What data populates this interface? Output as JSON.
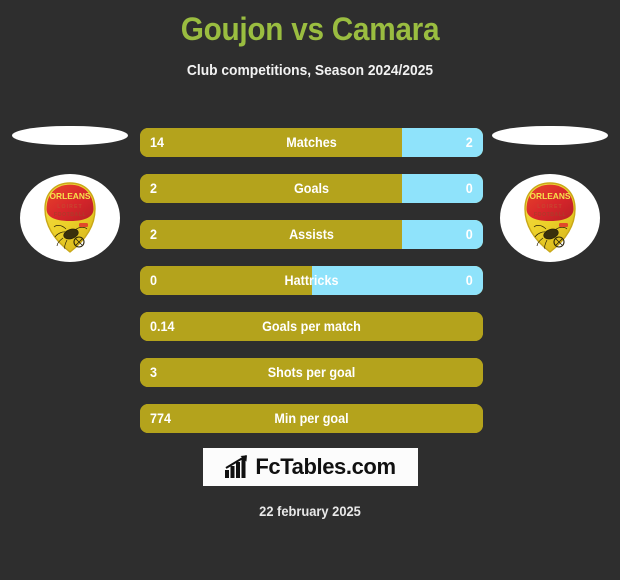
{
  "page": {
    "title": "Goujon vs Camara",
    "subtitle": "Club competitions, Season 2024/2025",
    "date": "22 february 2025",
    "background_color": "#2e2e2e",
    "title_color": "#9abd40",
    "home_color": "#b4a31c",
    "away_color": "#8fe3fb"
  },
  "teams": {
    "home": {
      "logo_name": "us-orleans-crest",
      "crest_lines": [
        "ORLEANS",
        "LOIRET",
        "FOOTBALL"
      ]
    },
    "away": {
      "logo_name": "us-orleans-crest",
      "crest_lines": [
        "ORLEANS",
        "LOIRET",
        "FOOTBALL"
      ]
    }
  },
  "stats": [
    {
      "label": "Matches",
      "home": "14",
      "away": "2",
      "home_pct": 76.5,
      "has_away": true
    },
    {
      "label": "Goals",
      "home": "2",
      "away": "0",
      "home_pct": 76.5,
      "has_away": true
    },
    {
      "label": "Assists",
      "home": "2",
      "away": "0",
      "home_pct": 76.5,
      "has_away": true
    },
    {
      "label": "Hattricks",
      "home": "0",
      "away": "0",
      "home_pct": 50.0,
      "has_away": true
    },
    {
      "label": "Goals per match",
      "home": "0.14",
      "away": "",
      "home_pct": 100,
      "has_away": false
    },
    {
      "label": "Shots per goal",
      "home": "3",
      "away": "",
      "home_pct": 100,
      "has_away": false
    },
    {
      "label": "Min per goal",
      "home": "774",
      "away": "",
      "home_pct": 100,
      "has_away": false
    }
  ],
  "brand": {
    "name": "FcTables.com",
    "icon": "bar-chart-arrow-icon"
  },
  "chart_data": {
    "type": "bar",
    "title": "Goujon vs Camara",
    "subtitle": "Club competitions, Season 2024/2025",
    "categories": [
      "Matches",
      "Goals",
      "Assists",
      "Hattricks",
      "Goals per match",
      "Shots per goal",
      "Min per goal"
    ],
    "series": [
      {
        "name": "Goujon",
        "values": [
          14,
          2,
          2,
          0,
          0.14,
          3,
          774
        ]
      },
      {
        "name": "Camara",
        "values": [
          2,
          0,
          0,
          0,
          null,
          null,
          null
        ]
      }
    ],
    "orientation": "horizontal-diverging",
    "legend": "none",
    "grid": false
  }
}
